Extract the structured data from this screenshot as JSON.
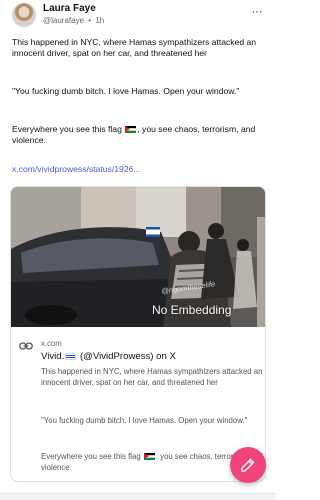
{
  "post": {
    "author": {
      "display_name": "Laura Faye",
      "handle": "@laurafaye",
      "separator": "•",
      "time": "1h"
    },
    "text": {
      "p1": "This happened in NYC, where Hamas sympathizers attacked an innocent driver, spat on her car, and threatened her",
      "p2": "\"You fucking dumb bitch. I love Hamas. Open your window.\"",
      "p3_before": "Everywhere you see this flag ",
      "p3_after": ", you see chaos, terrorism, and violence.",
      "link": "x.com/vividprowess/status/1926..."
    },
    "embed": {
      "watermark": "@ngomtheselife",
      "overlay": "No Embedding",
      "source": "x.com",
      "title_before": "Vivid.",
      "title_after": " (@VividProwess) on X",
      "d1": "This happened in NYC, where Hamas sympathizers attacked an innocent driver, spat on her car, and threatened her",
      "d2": "\"You fucking dumb bitch. I love Hamas. Open your window.\"",
      "d3_before": "Everywhere you see this flag ",
      "d3_after": ", you see chaos, terrorism, and violence."
    }
  },
  "icons": {
    "more": "ellipsis-icon",
    "link": "link-icon",
    "fab": "edit-icon",
    "flag_palestine": "palestine-flag-icon",
    "flag_israel": "israel-flag-icon"
  },
  "colors": {
    "link": "#4a5dd8",
    "fab": "#f0457a",
    "text": "#111111",
    "muted": "#666666"
  }
}
